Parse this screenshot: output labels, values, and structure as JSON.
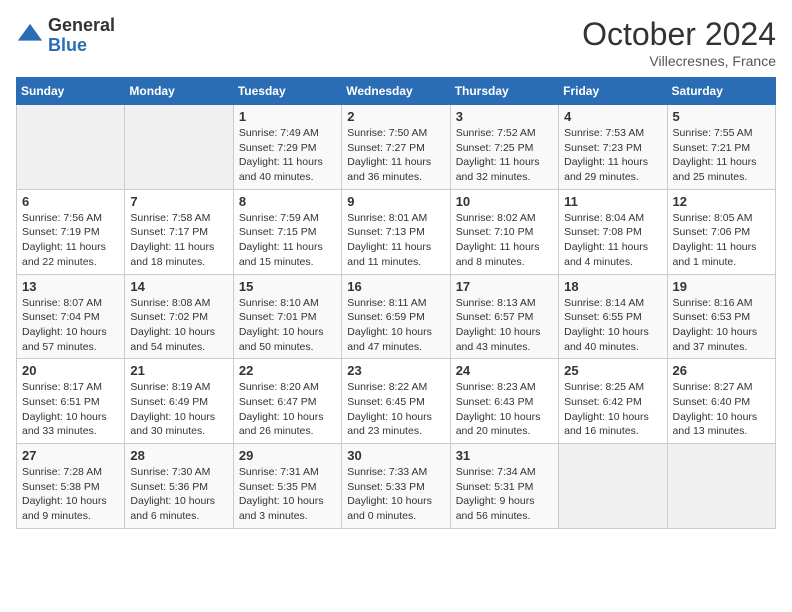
{
  "logo": {
    "general": "General",
    "blue": "Blue"
  },
  "title": "October 2024",
  "location": "Villecresnes, France",
  "weekdays": [
    "Sunday",
    "Monday",
    "Tuesday",
    "Wednesday",
    "Thursday",
    "Friday",
    "Saturday"
  ],
  "weeks": [
    [
      {
        "day": "",
        "info": ""
      },
      {
        "day": "",
        "info": ""
      },
      {
        "day": "1",
        "info": "Sunrise: 7:49 AM\nSunset: 7:29 PM\nDaylight: 11 hours and 40 minutes."
      },
      {
        "day": "2",
        "info": "Sunrise: 7:50 AM\nSunset: 7:27 PM\nDaylight: 11 hours and 36 minutes."
      },
      {
        "day": "3",
        "info": "Sunrise: 7:52 AM\nSunset: 7:25 PM\nDaylight: 11 hours and 32 minutes."
      },
      {
        "day": "4",
        "info": "Sunrise: 7:53 AM\nSunset: 7:23 PM\nDaylight: 11 hours and 29 minutes."
      },
      {
        "day": "5",
        "info": "Sunrise: 7:55 AM\nSunset: 7:21 PM\nDaylight: 11 hours and 25 minutes."
      }
    ],
    [
      {
        "day": "6",
        "info": "Sunrise: 7:56 AM\nSunset: 7:19 PM\nDaylight: 11 hours and 22 minutes."
      },
      {
        "day": "7",
        "info": "Sunrise: 7:58 AM\nSunset: 7:17 PM\nDaylight: 11 hours and 18 minutes."
      },
      {
        "day": "8",
        "info": "Sunrise: 7:59 AM\nSunset: 7:15 PM\nDaylight: 11 hours and 15 minutes."
      },
      {
        "day": "9",
        "info": "Sunrise: 8:01 AM\nSunset: 7:13 PM\nDaylight: 11 hours and 11 minutes."
      },
      {
        "day": "10",
        "info": "Sunrise: 8:02 AM\nSunset: 7:10 PM\nDaylight: 11 hours and 8 minutes."
      },
      {
        "day": "11",
        "info": "Sunrise: 8:04 AM\nSunset: 7:08 PM\nDaylight: 11 hours and 4 minutes."
      },
      {
        "day": "12",
        "info": "Sunrise: 8:05 AM\nSunset: 7:06 PM\nDaylight: 11 hours and 1 minute."
      }
    ],
    [
      {
        "day": "13",
        "info": "Sunrise: 8:07 AM\nSunset: 7:04 PM\nDaylight: 10 hours and 57 minutes."
      },
      {
        "day": "14",
        "info": "Sunrise: 8:08 AM\nSunset: 7:02 PM\nDaylight: 10 hours and 54 minutes."
      },
      {
        "day": "15",
        "info": "Sunrise: 8:10 AM\nSunset: 7:01 PM\nDaylight: 10 hours and 50 minutes."
      },
      {
        "day": "16",
        "info": "Sunrise: 8:11 AM\nSunset: 6:59 PM\nDaylight: 10 hours and 47 minutes."
      },
      {
        "day": "17",
        "info": "Sunrise: 8:13 AM\nSunset: 6:57 PM\nDaylight: 10 hours and 43 minutes."
      },
      {
        "day": "18",
        "info": "Sunrise: 8:14 AM\nSunset: 6:55 PM\nDaylight: 10 hours and 40 minutes."
      },
      {
        "day": "19",
        "info": "Sunrise: 8:16 AM\nSunset: 6:53 PM\nDaylight: 10 hours and 37 minutes."
      }
    ],
    [
      {
        "day": "20",
        "info": "Sunrise: 8:17 AM\nSunset: 6:51 PM\nDaylight: 10 hours and 33 minutes."
      },
      {
        "day": "21",
        "info": "Sunrise: 8:19 AM\nSunset: 6:49 PM\nDaylight: 10 hours and 30 minutes."
      },
      {
        "day": "22",
        "info": "Sunrise: 8:20 AM\nSunset: 6:47 PM\nDaylight: 10 hours and 26 minutes."
      },
      {
        "day": "23",
        "info": "Sunrise: 8:22 AM\nSunset: 6:45 PM\nDaylight: 10 hours and 23 minutes."
      },
      {
        "day": "24",
        "info": "Sunrise: 8:23 AM\nSunset: 6:43 PM\nDaylight: 10 hours and 20 minutes."
      },
      {
        "day": "25",
        "info": "Sunrise: 8:25 AM\nSunset: 6:42 PM\nDaylight: 10 hours and 16 minutes."
      },
      {
        "day": "26",
        "info": "Sunrise: 8:27 AM\nSunset: 6:40 PM\nDaylight: 10 hours and 13 minutes."
      }
    ],
    [
      {
        "day": "27",
        "info": "Sunrise: 7:28 AM\nSunset: 5:38 PM\nDaylight: 10 hours and 9 minutes."
      },
      {
        "day": "28",
        "info": "Sunrise: 7:30 AM\nSunset: 5:36 PM\nDaylight: 10 hours and 6 minutes."
      },
      {
        "day": "29",
        "info": "Sunrise: 7:31 AM\nSunset: 5:35 PM\nDaylight: 10 hours and 3 minutes."
      },
      {
        "day": "30",
        "info": "Sunrise: 7:33 AM\nSunset: 5:33 PM\nDaylight: 10 hours and 0 minutes."
      },
      {
        "day": "31",
        "info": "Sunrise: 7:34 AM\nSunset: 5:31 PM\nDaylight: 9 hours and 56 minutes."
      },
      {
        "day": "",
        "info": ""
      },
      {
        "day": "",
        "info": ""
      }
    ]
  ]
}
